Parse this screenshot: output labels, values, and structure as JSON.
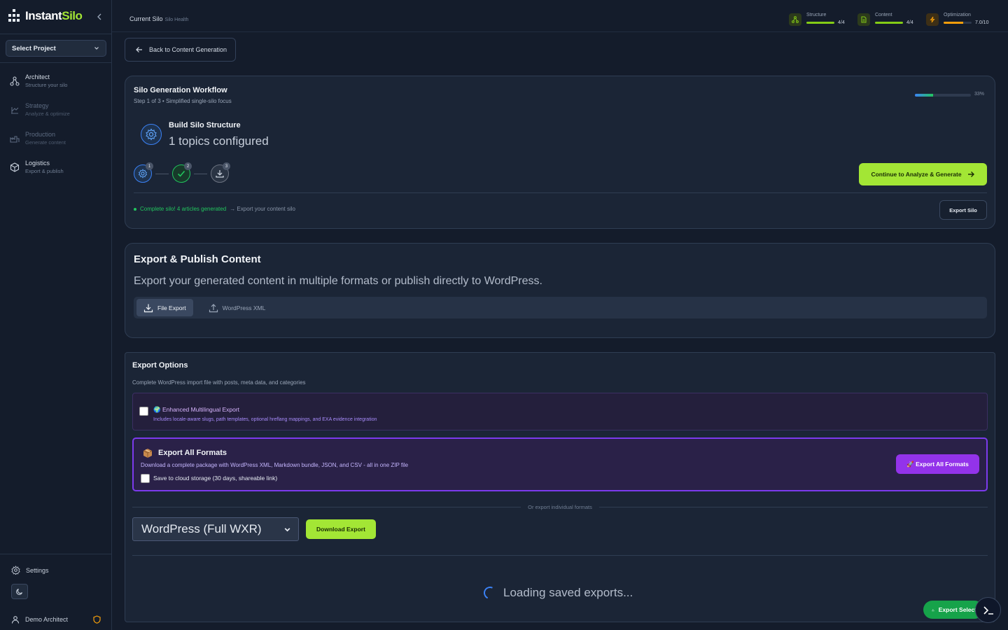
{
  "app": {
    "logo_text_1": "Instant",
    "logo_text_2": "Silo"
  },
  "sidebar": {
    "project_select": "Select Project",
    "items": [
      {
        "title": "Architect",
        "subtitle": "Structure your silo",
        "icon": "architect-icon",
        "enabled": true
      },
      {
        "title": "Strategy",
        "subtitle": "Analyze & optimize",
        "icon": "strategy-icon",
        "enabled": false
      },
      {
        "title": "Production",
        "subtitle": "Generate content",
        "icon": "production-icon",
        "enabled": false
      },
      {
        "title": "Logistics",
        "subtitle": "Export & publish",
        "icon": "box-icon",
        "enabled": true
      }
    ],
    "settings_label": "Settings",
    "user_name": "Demo Architect"
  },
  "topbar": {
    "crumb_main": "Current Silo",
    "crumb_sub": "Silo Health",
    "metrics": [
      {
        "label": "Structure",
        "value": "4/4",
        "fill": 1.0,
        "color": "#84cc16",
        "icon": "structure-icon"
      },
      {
        "label": "Content",
        "value": "4/4",
        "fill": 1.0,
        "color": "#84cc16",
        "icon": "document-icon"
      },
      {
        "label": "Optimization",
        "value": "7.0/10",
        "fill": 0.7,
        "color": "#f59e0b",
        "icon": "lightning-icon"
      }
    ]
  },
  "back_button": "Back to Content Generation",
  "workflow": {
    "title": "Silo Generation Workflow",
    "subtitle": "Step 1 of 3 • Simplified single-silo focus",
    "progress_pct": "33%",
    "progress": 0.33,
    "step_title": "Build Silo Structure",
    "step_detail": "1 topics configured",
    "steps": [
      "1",
      "2",
      "3"
    ],
    "continue_label": "Continue to Analyze & Generate",
    "complete_text": "Complete silo! 4 articles generated",
    "complete_suffix": "→ Export your content silo",
    "export_silo_label": "Export Silo"
  },
  "export_publish": {
    "title": "Export & Publish Content",
    "description": "Export your generated content in multiple formats or publish directly to WordPress.",
    "tabs": [
      {
        "label": "File Export",
        "active": true
      },
      {
        "label": "WordPress XML",
        "active": false
      }
    ]
  },
  "export_options": {
    "title": "Export Options",
    "subtitle": "Complete WordPress import file with posts, meta data, and categories",
    "multilingual_title": "🌍 Enhanced Multilingual Export",
    "multilingual_desc": "Includes locale-aware slugs, path templates, optional hreflang mappings, and EXA evidence integration",
    "all_formats_title": "Export All Formats",
    "all_formats_desc": "Download a complete package with WordPress XML, Markdown bundle, JSON, and CSV - all in one ZIP file",
    "cloud_label": "Save to cloud storage (30 days, shareable link)",
    "all_formats_button": "🚀 Export All Formats",
    "or_text": "Or export individual formats",
    "format_selected": "WordPress (Full WXR)",
    "download_label": "Download Export",
    "loading_text": "Loading saved exports..."
  },
  "floating": {
    "export_selected": "Export Selected"
  },
  "colors": {
    "accent_green": "#a3e635",
    "accent_purple": "#9333ea",
    "primary_blue": "#3b82f6",
    "success": "#22c55e"
  }
}
